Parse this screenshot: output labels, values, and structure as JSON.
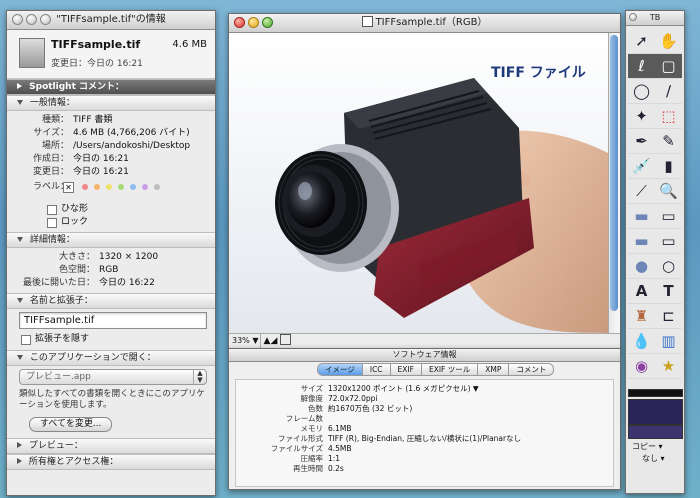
{
  "info_window": {
    "title": "\"TIFFsample.tif\"の情報",
    "file_name": "TIFFsample.tif",
    "file_size": "4.6 MB",
    "modified": "変更日：今日の 16:21",
    "spotlight": "Spotlight コメント：",
    "general": {
      "header": "一般情報：",
      "rows": [
        {
          "k": "種類：",
          "v": "TIFF 書類"
        },
        {
          "k": "サイズ：",
          "v": "4.6 MB (4,766,206 バイト)"
        },
        {
          "k": "場所：",
          "v": "/Users/andokoshi/Desktop"
        },
        {
          "k": "作成日：",
          "v": "今日の 16:21"
        },
        {
          "k": "変更日：",
          "v": "今日の 16:21"
        }
      ],
      "label_caption": "ラベル：",
      "label_x": "✕",
      "label_colors": [
        "#f08a8a",
        "#f3b56a",
        "#eee46b",
        "#a8dd76",
        "#8bbdf0",
        "#c89ee6",
        "#bdbdbd"
      ],
      "stationery": "ひな形",
      "locked": "ロック"
    },
    "details": {
      "header": "詳細情報：",
      "rows": [
        {
          "k": "大きさ：",
          "v": "1320 × 1200"
        },
        {
          "k": "色空間：",
          "v": "RGB"
        },
        {
          "k": "最後に開いた日：",
          "v": "今日の 16:22"
        }
      ]
    },
    "name_ext": {
      "header": "名前と拡張子：",
      "value": "TIFFsample.tif",
      "hide_ext": "拡張子を隠す"
    },
    "open_with": {
      "header": "このアプリケーションで開く：",
      "app": "プレビュー.app",
      "arrows": "▲▼",
      "description": "類似したすべての書類を開くときにこのアプリケーションを使用します。",
      "change_all": "すべてを変更..."
    },
    "preview": "プレビュー：",
    "ownership": "所有権とアクセス権："
  },
  "image_window": {
    "title": "TIFFsample.tif（RGB）",
    "overlay_text": "TIFF ファイル",
    "zoom": "33%",
    "zoom_arrow": "▼"
  },
  "software_info": {
    "title": "ソフトウェア情報",
    "tabs": [
      "イメージ",
      "ICC",
      "EXIF",
      "EXIF ツール",
      "XMP",
      "コメント"
    ],
    "rows": [
      {
        "k": "サイズ",
        "v": "1320x1200 ポイント (1.6 メガピクセル) ▼"
      },
      {
        "k": "解像度",
        "v": "72.0x72.0ppi"
      },
      {
        "k": "色数",
        "v": "約1670万色 (32 ビット)"
      },
      {
        "k": "フレーム数",
        "v": ""
      },
      {
        "k": "メモリ",
        "v": "6.1MB"
      },
      {
        "k": "ファイル形式",
        "v": "TIFF (R), Big-Endian, 圧縮しない/横状に(1)/Planarなし"
      },
      {
        "k": "ファイルサイズ",
        "v": "4.5MB"
      },
      {
        "k": "圧縮率",
        "v": "1:1"
      },
      {
        "k": "再生時間",
        "v": "0.2s"
      }
    ]
  },
  "tools": {
    "title": "TB",
    "copy": "コピー",
    "none": "なし",
    "icons": [
      "arrow",
      "hand",
      "lasso",
      "rect-select",
      "circle",
      "line",
      "magic-wand",
      "rect-outline",
      "pen",
      "pencil",
      "eyedropper",
      "eraser",
      "line-tool",
      "magnifier",
      "rectangle",
      "rectangle-outline",
      "rounded-rect",
      "rounded-rect-outline",
      "ellipse",
      "ellipse-outline",
      "text",
      "text-alt",
      "stamp",
      "clamp",
      "drop",
      "bucket",
      "eye",
      "star"
    ]
  }
}
